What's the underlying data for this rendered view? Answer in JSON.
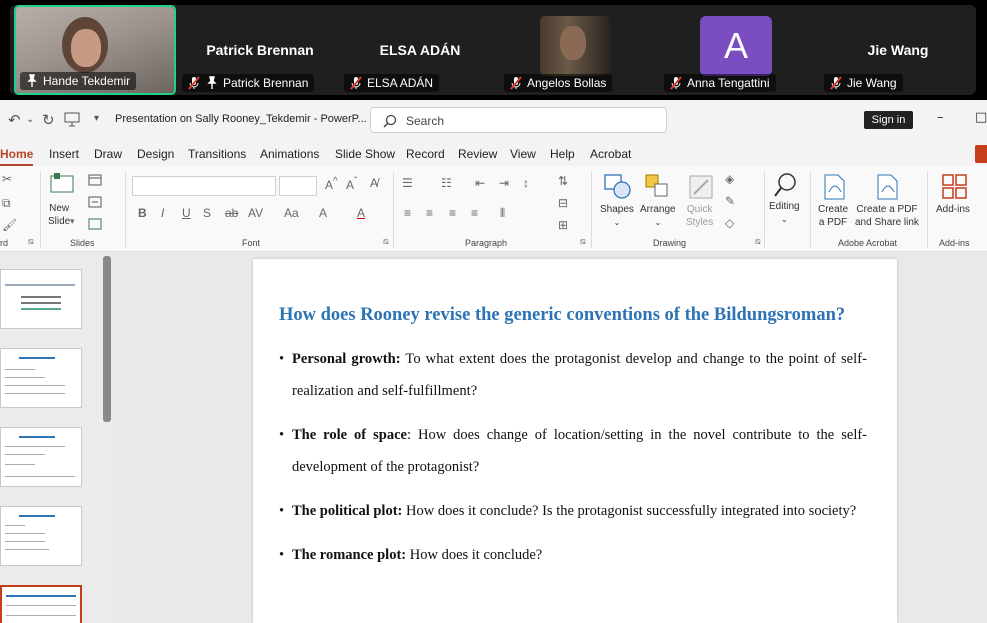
{
  "meeting": {
    "participants": [
      {
        "name": "Hande Tekdemir",
        "display": "video"
      },
      {
        "name": "Patrick Brennan",
        "display": "name"
      },
      {
        "name": "ELSA ADÁN",
        "display": "name"
      },
      {
        "name": "Angelos Bollas",
        "display": "photo"
      },
      {
        "name": "Anna Tengattini",
        "display": "initial",
        "initial": "A",
        "color": "#7a4ec1"
      },
      {
        "name": "Jie Wang",
        "display": "name"
      }
    ]
  },
  "titlebar": {
    "doc_title": "Presentation on Sally Rooney_Tekdemir - PowerP...",
    "search_placeholder": "Search",
    "signin_label": "Sign in"
  },
  "menu": {
    "tabs": [
      "Home",
      "Insert",
      "Draw",
      "Design",
      "Transitions",
      "Animations",
      "Slide Show",
      "Record",
      "Review",
      "View",
      "Help",
      "Acrobat"
    ],
    "active": "Home"
  },
  "ribbon": {
    "groups": {
      "clipboard": "rd",
      "slides": "Slides",
      "font": "Font",
      "paragraph": "Paragraph",
      "drawing": "Drawing",
      "adobe": "Adobe Acrobat",
      "addins": "Add-ins"
    },
    "buttons": {
      "new_slide_1": "New",
      "new_slide_2": "Slide",
      "shapes": "Shapes",
      "arrange": "Arrange",
      "quick_1": "Quick",
      "quick_2": "Styles",
      "editing": "Editing",
      "create_pdf_1": "Create",
      "create_pdf_2": "a PDF",
      "create_share_1": "Create a PDF",
      "create_share_2": "and Share link",
      "addins": "Add-ins"
    },
    "font_buttons": [
      "B",
      "I",
      "U",
      "S",
      "ab",
      "AV",
      "Aa",
      "A",
      "A"
    ]
  },
  "slide": {
    "title": "How does Rooney revise the generic conventions of the Bildungsroman?",
    "bullets": [
      {
        "bold": "Personal growth:",
        "text": " To what extent does the protagonist develop and change to the point of self-realization and self-fulfillment?"
      },
      {
        "bold": "The role of space",
        "text": ": How does change of location/setting in the novel contribute to the self-development of the protagonist?"
      },
      {
        "bold": "The political plot:",
        "text": " How does it conclude? Is the protagonist successfully integrated into society?"
      },
      {
        "bold": "The romance plot:",
        "text": " How does it conclude?"
      }
    ]
  },
  "thumbnails": {
    "count": 5,
    "selected_index": 4
  }
}
